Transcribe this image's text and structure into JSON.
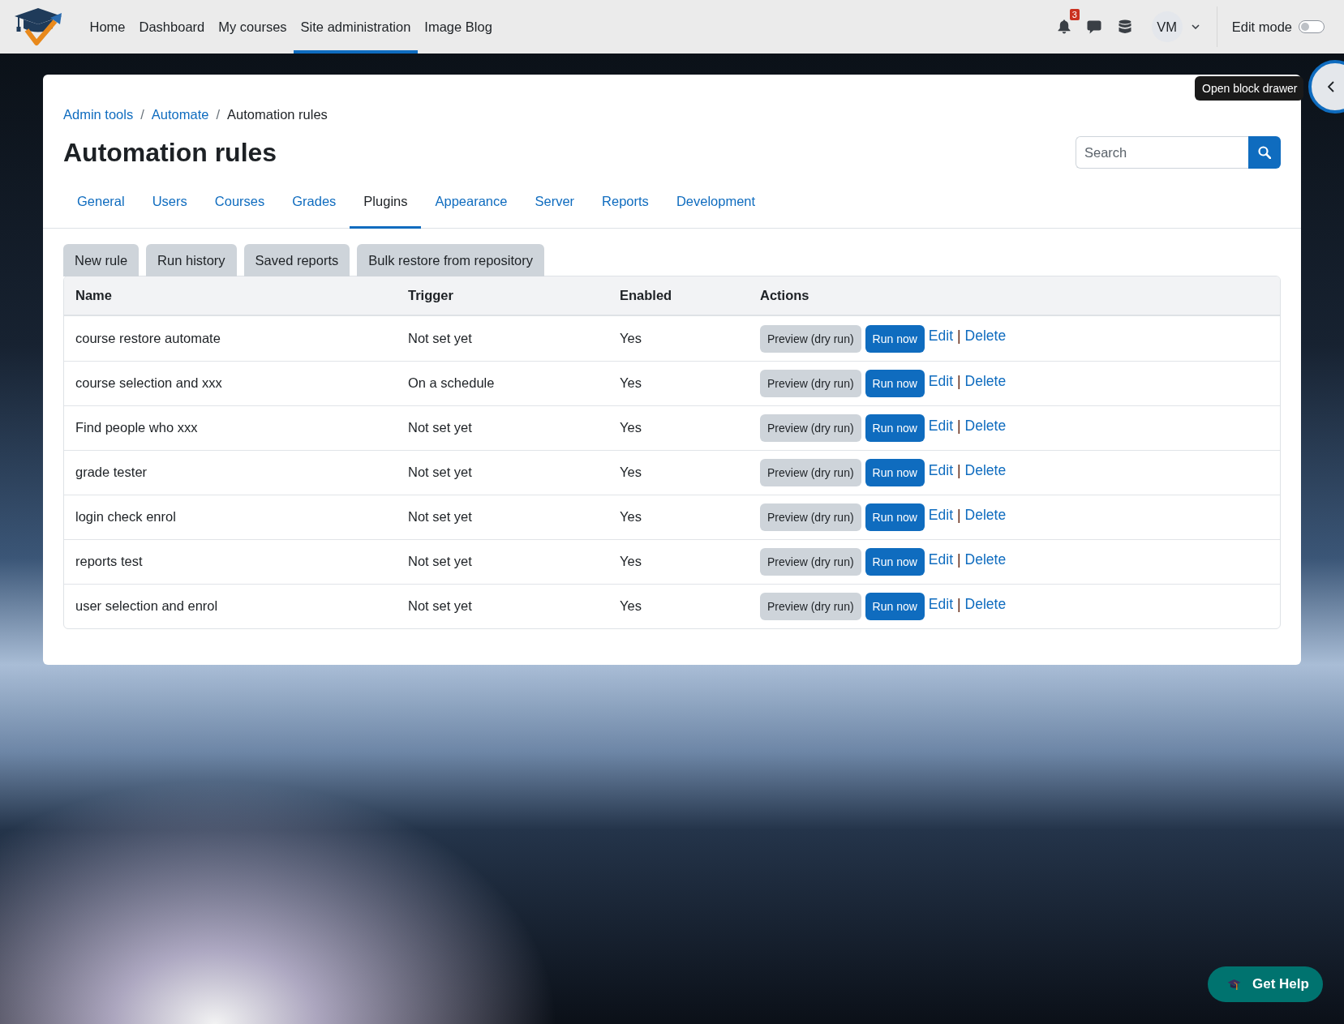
{
  "navbar": {
    "nav_items": [
      {
        "label": "Home",
        "selected": false
      },
      {
        "label": "Dashboard",
        "selected": false
      },
      {
        "label": "My courses",
        "selected": false
      },
      {
        "label": "Site administration",
        "selected": true
      },
      {
        "label": "Image Blog",
        "selected": false
      }
    ],
    "notifications": {
      "badge": "3"
    },
    "user": {
      "initials": "VM"
    },
    "edit_mode": {
      "label": "Edit mode",
      "on": false
    }
  },
  "drawer": {
    "tooltip": "Open block drawer"
  },
  "breadcrumb": [
    {
      "label": "Admin tools",
      "kind": "link"
    },
    {
      "label": "/",
      "kind": "separator"
    },
    {
      "label": "Automate",
      "kind": "link"
    },
    {
      "label": "/",
      "kind": "separator"
    },
    {
      "label": "Automation rules",
      "kind": "current"
    }
  ],
  "page_title": "Automation rules",
  "search": {
    "placeholder": "Search"
  },
  "tabs": [
    {
      "label": "General",
      "selected": false
    },
    {
      "label": "Users",
      "selected": false
    },
    {
      "label": "Courses",
      "selected": false
    },
    {
      "label": "Grades",
      "selected": false
    },
    {
      "label": "Plugins",
      "selected": true
    },
    {
      "label": "Appearance",
      "selected": false
    },
    {
      "label": "Server",
      "selected": false
    },
    {
      "label": "Reports",
      "selected": false
    },
    {
      "label": "Development",
      "selected": false
    }
  ],
  "action_buttons": [
    "New rule",
    "Run history",
    "Saved reports",
    "Bulk restore from repository"
  ],
  "table": {
    "columns": [
      "Name",
      "Trigger",
      "Enabled",
      "Actions"
    ],
    "rows": [
      {
        "name": "course restore automate",
        "trigger": "Not set yet",
        "enabled": "Yes",
        "actions": {
          "preview": "Preview (dry run)",
          "run": "Run now",
          "edit": "Edit",
          "separator": "|",
          "delete": "Delete"
        }
      },
      {
        "name": "course selection and xxx",
        "trigger": "On a schedule",
        "enabled": "Yes",
        "actions": {
          "preview": "Preview (dry run)",
          "run": "Run now",
          "edit": "Edit",
          "separator": "|",
          "delete": "Delete"
        }
      },
      {
        "name": "Find people who xxx",
        "trigger": "Not set yet",
        "enabled": "Yes",
        "actions": {
          "preview": "Preview (dry run)",
          "run": "Run now",
          "edit": "Edit",
          "separator": "|",
          "delete": "Delete"
        }
      },
      {
        "name": "grade tester",
        "trigger": "Not set yet",
        "enabled": "Yes",
        "actions": {
          "preview": "Preview (dry run)",
          "run": "Run now",
          "edit": "Edit",
          "separator": "|",
          "delete": "Delete"
        }
      },
      {
        "name": "login check enrol",
        "trigger": "Not set yet",
        "enabled": "Yes",
        "actions": {
          "preview": "Preview (dry run)",
          "run": "Run now",
          "edit": "Edit",
          "separator": "|",
          "delete": "Delete"
        }
      },
      {
        "name": "reports test",
        "trigger": "Not set yet",
        "enabled": "Yes",
        "actions": {
          "preview": "Preview (dry run)",
          "run": "Run now",
          "edit": "Edit",
          "separator": "|",
          "delete": "Delete"
        }
      },
      {
        "name": "user selection and enrol",
        "trigger": "Not set yet",
        "enabled": "Yes",
        "actions": {
          "preview": "Preview (dry run)",
          "run": "Run now",
          "edit": "Edit",
          "separator": "|",
          "delete": "Delete"
        }
      }
    ]
  },
  "help_button": {
    "label": "Get Help"
  }
}
